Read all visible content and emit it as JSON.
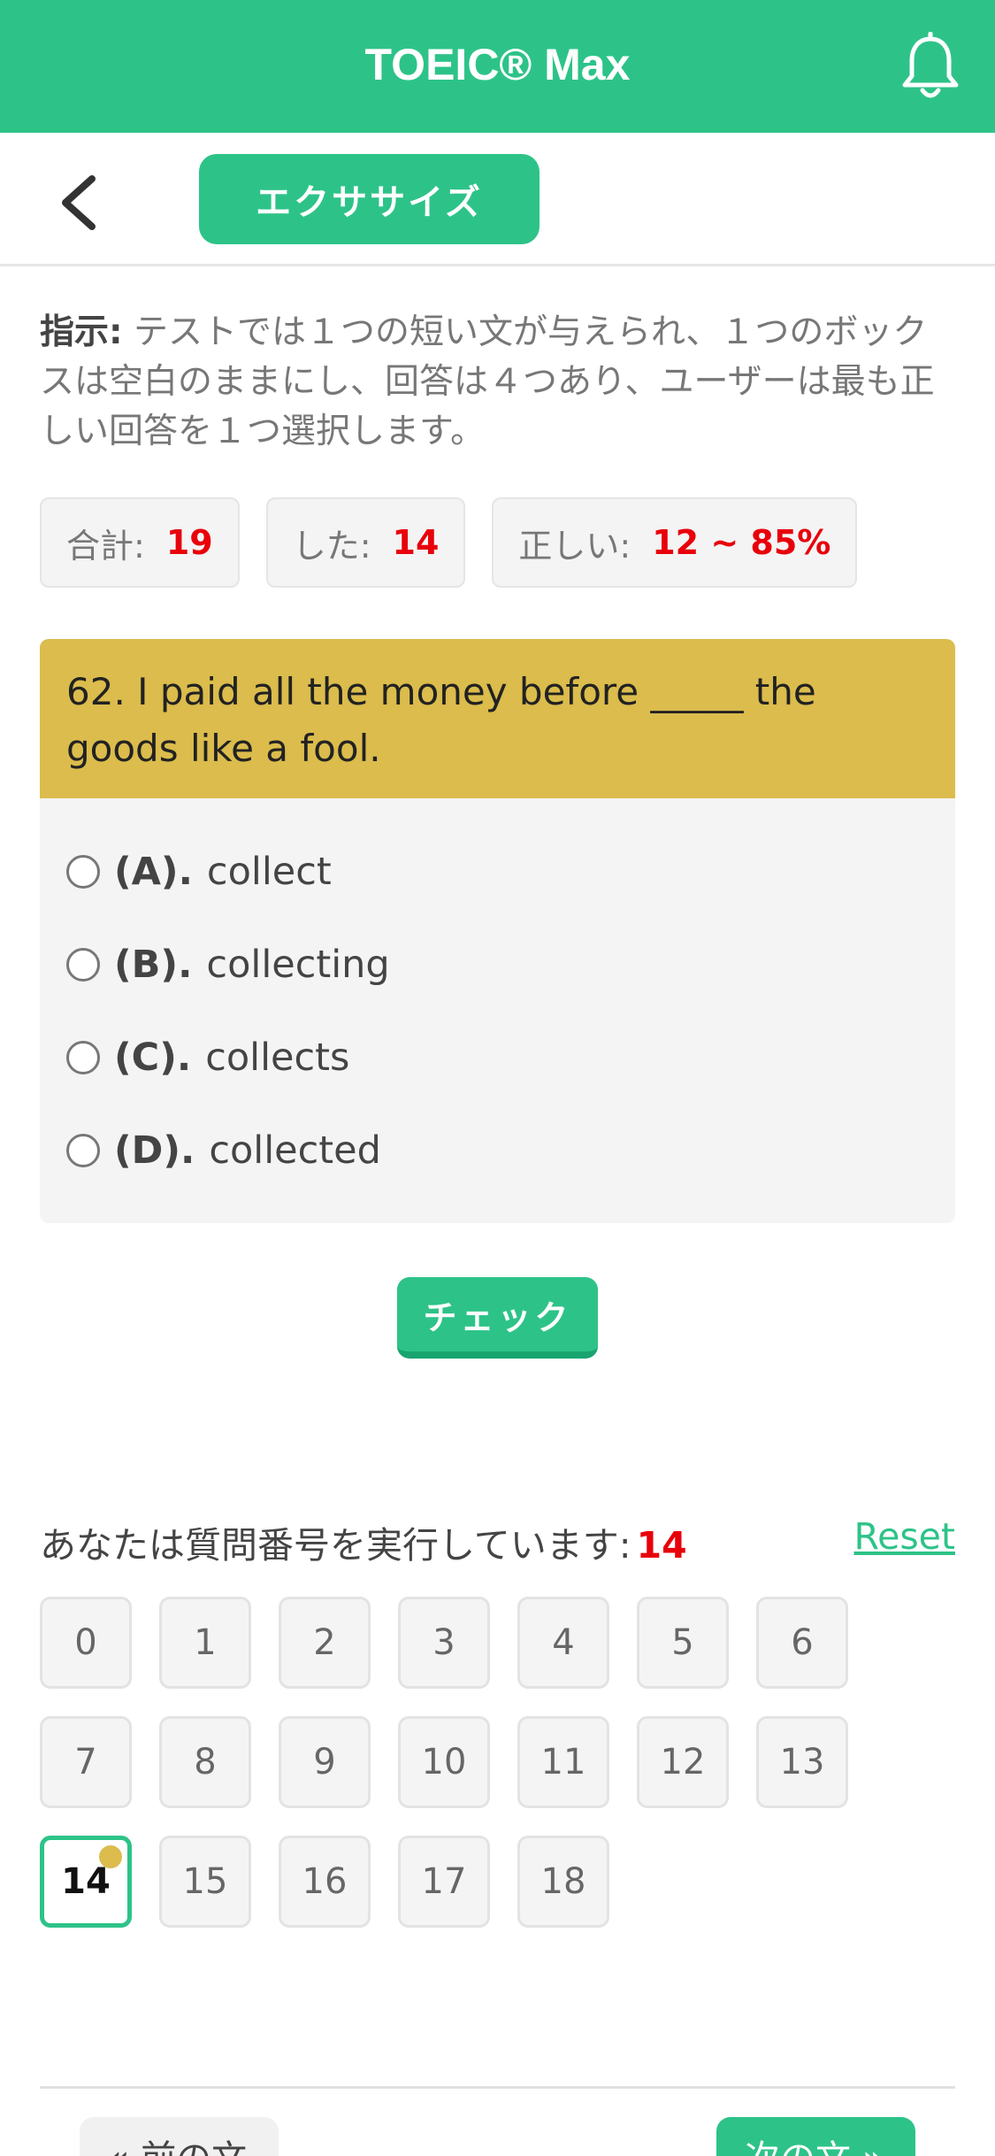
{
  "app": {
    "title": "TOEIC® Max"
  },
  "subbar": {
    "mode_label": "エクササイズ"
  },
  "instruction": {
    "label": "指示:",
    "text": " テストでは１つの短い文が与えられ、１つのボックスは空白のままにし、回答は４つあり、ユーザーは最も正しい回答を１つ選択します。"
  },
  "stats": {
    "total_label": "合計:",
    "total_value": "19",
    "done_label": "した:",
    "done_value": "14",
    "correct_label": "正しい:",
    "correct_value": "12 ~ 85%"
  },
  "question": {
    "text": "62. I paid all the money before _____ the goods like a fool.",
    "options": [
      {
        "label": "(A).",
        "text": "collect"
      },
      {
        "label": "(B).",
        "text": "collecting"
      },
      {
        "label": "(C).",
        "text": "collects"
      },
      {
        "label": "(D).",
        "text": "collected"
      }
    ]
  },
  "check_label": "チェック",
  "progress": {
    "text": "あなたは質問番号を実行しています:",
    "current": "14",
    "reset_label": "Reset"
  },
  "question_numbers": [
    "0",
    "1",
    "2",
    "3",
    "4",
    "5",
    "6",
    "7",
    "8",
    "9",
    "10",
    "11",
    "12",
    "13",
    "14",
    "15",
    "16",
    "17",
    "18"
  ],
  "active_question": 14,
  "nav": {
    "prev_label": "« 前の文",
    "next_label": "次の文 »"
  },
  "colors": {
    "primary": "#2dc388",
    "question_bg": "#dbbc4c",
    "accent_red": "#e8000b"
  }
}
